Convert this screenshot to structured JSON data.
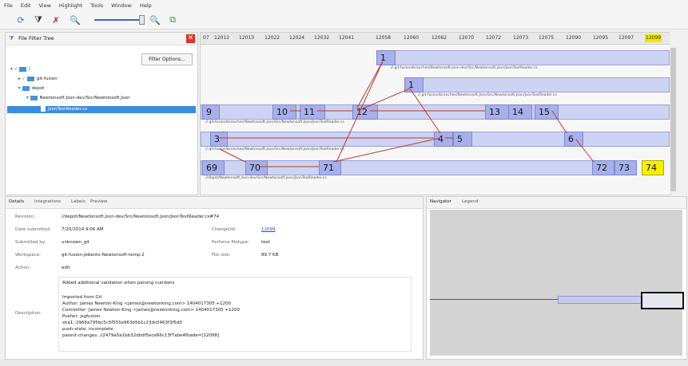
{
  "menu": [
    "File",
    "Edit",
    "View",
    "Highlight",
    "Tools",
    "Window",
    "Help"
  ],
  "file_filter": {
    "title": "File Filter Tree",
    "filter_button": "Filter Options...",
    "tree": [
      {
        "label": "/",
        "indent": 0
      },
      {
        "label": "git-fusion",
        "indent": 1
      },
      {
        "label": "depot",
        "indent": 1
      },
      {
        "label": "Newtonsoft.Json-dev/Src/Newtonsoft.Json",
        "indent": 2
      },
      {
        "label": "JsonTextReader.cs",
        "indent": 3,
        "selected": true
      }
    ]
  },
  "ruler": [
    "07",
    "12012",
    "12013",
    "12022",
    "12024",
    "12032",
    "12041",
    "12058",
    "12060",
    "12062",
    "12070",
    "12072",
    "12073",
    "12075",
    "12090",
    "12095",
    "12097",
    "12099"
  ],
  "graph": {
    "revs": [
      "1",
      "1",
      "9",
      "10",
      "11",
      "12",
      "13",
      "14",
      "15",
      "3",
      "4",
      "5",
      "6",
      "69",
      "70",
      "71",
      "72",
      "73",
      "74"
    ],
    "paths": [
      "//.git-fusion/branches/Newtonsoft.Json-dev/Src/Newtonsoft.Json/JsonTextReader.cs",
      "//.git-fusion/branches/Newtonsoft.Json/Src/Newtonsoft.Json/JsonTextReader.cs",
      "//.git-fusion/branches/Newtonsoft.Json/Src/Newtonsoft.Json/JsonTextReader.cs",
      "//.git-fusion/branches/Newtonsoft.Json/Src/Newtonsoft.Json/JsonTextReader.cs",
      "//depot/Newtonsoft.Json-dev/Src/Newtonsoft.Json/JsonTextReader.cs"
    ]
  },
  "details": {
    "tabs": [
      "Details",
      "Integrations",
      "Labels",
      "Preview"
    ],
    "fields": {
      "revision": {
        "label": "Revision:",
        "value": "//depot/Newtonsoft.Json-dev/Src/Newtonsoft.Json/JsonTextReader.cs#74"
      },
      "date": {
        "label": "Date submitted:",
        "value": "7/20/2014 9:06 AM"
      },
      "submitted_by": {
        "label": "Submitted by:",
        "value": "unknown_git"
      },
      "workspace": {
        "label": "Workspace:",
        "value": "git-fusion-jebento-Newtonsoft-temp-2"
      },
      "action": {
        "label": "Action:",
        "value": "edit"
      },
      "changelist": {
        "label": "Changelist:",
        "value": "12099"
      },
      "perforce_filetype": {
        "label": "Perforce filetype:",
        "value": "text"
      },
      "file_size": {
        "label": "File size:",
        "value": "89.7 KB"
      },
      "description_label": "Description:"
    },
    "description": [
      "Added additional validation when parsing numbers",
      "",
      "Imported from Git",
      "Author: James Newton-King <james@newtonking.com> 1404017305 +1200",
      "Committer: James Newton-King <james@newtonking.com> 1404017305 +1200",
      "Pusher: jsgfuston",
      "sha1: 2966a795bc5c5f555e963b5b1c23dc0463f3f5d0",
      "push-state: incomplete",
      "parent-changes: //2479a5a1bb32dbdf5ece66c13f7abe4fbade=[12098]"
    ]
  },
  "navigator": {
    "tabs": [
      "Navigator",
      "Legend"
    ]
  },
  "colors": {
    "rev_fill": "#a7b0ea",
    "bar_fill": "#cdd3f2",
    "highlight": "#f7ee00",
    "arrow": "#c0392b"
  }
}
